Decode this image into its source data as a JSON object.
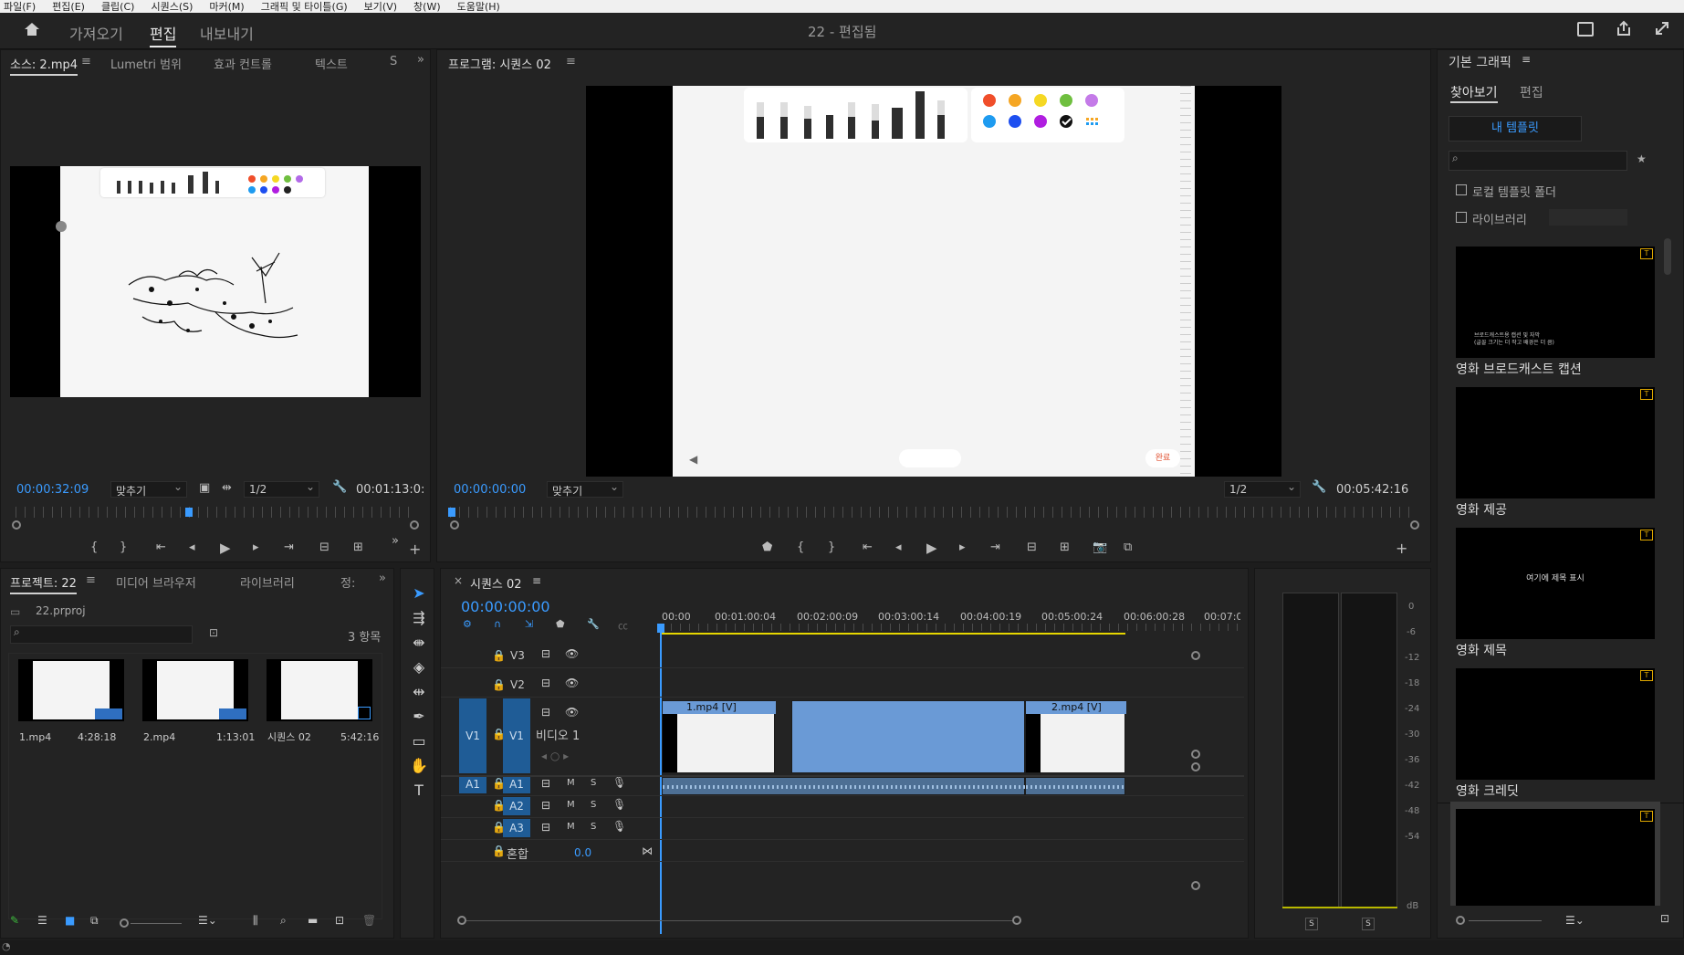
{
  "menu": [
    "파일(F)",
    "편집(E)",
    "클립(C)",
    "시퀀스(S)",
    "마커(M)",
    "그래픽 및 타이틀(G)",
    "보기(V)",
    "창(W)",
    "도움말(H)"
  ],
  "workspace": {
    "tabs": [
      "가져오기",
      "편집",
      "내보내기"
    ],
    "active": "편집",
    "title": "22 - 편집됨"
  },
  "source": {
    "tabs": [
      "소스: 2.mp4",
      "Lumetri 범위",
      "효과 컨트롤",
      "텍스트",
      "S"
    ],
    "timecode": "00:00:32:09",
    "fit": "맞추기",
    "resolution": "1/2",
    "duration": "00:01:13:0:"
  },
  "program": {
    "tab": "프로그램: 시퀀스 02",
    "timecode": "00:00:00:00",
    "fit": "맞추기",
    "resolution": "1/2",
    "duration": "00:05:42:16",
    "done_label": "완료"
  },
  "project": {
    "tabs": [
      "프로젝트: 22",
      "미디어 브라우저",
      "라이브러리",
      "정:"
    ],
    "file": "22.prproj",
    "count": "3 항목",
    "items": [
      {
        "name": "1.mp4",
        "duration": "4:28:18"
      },
      {
        "name": "2.mp4",
        "duration": "1:13:01"
      },
      {
        "name": "시퀀스 02",
        "duration": "5:42:16"
      }
    ]
  },
  "timeline": {
    "tab": "시퀀스 02",
    "timecode": "00:00:00:00",
    "ruler": [
      "00:00",
      "00:01:00:04",
      "00:02:00:09",
      "00:03:00:14",
      "00:04:00:19",
      "00:05:00:24",
      "00:06:00:28",
      "00:07:0("
    ],
    "video_tracks": [
      "V3",
      "V2",
      "V1"
    ],
    "v1_name": "비디오 1",
    "audio_tracks": [
      "A1",
      "A2",
      "A3"
    ],
    "source_patch": {
      "video": "V1",
      "audio": "A1"
    },
    "mix_label": "혼합",
    "mix_value": "0.0",
    "mute": "M",
    "solo": "S",
    "clips": [
      "1.mp4 [V]",
      "2.mp4 [V]"
    ]
  },
  "meter": {
    "scale": [
      "0",
      "-6",
      "-12",
      "-18",
      "-24",
      "-30",
      "-36",
      "-42",
      "-48",
      "-54",
      "dB"
    ],
    "solo": [
      "S",
      "S"
    ]
  },
  "essential": {
    "title": "기본 그래픽",
    "tabs": [
      "찾아보기",
      "편집"
    ],
    "active_tab": "찾아보기",
    "my_templates": "내 템플릿",
    "local_folder": "로컬 템플릿 폴더",
    "library": "라이브러리",
    "templates": [
      "영화 브로드캐스트 캡션",
      "영화 제공",
      "영화 제목",
      "영화 크레딧"
    ],
    "thumb_text_1": "브로드캐스트용 캡션 및 자막\n(글꼴 크기는 더 작고 배경은 더 큼)",
    "thumb_text_3": "여기에 제목 표시"
  },
  "colors": {
    "accent": "#3a9bff",
    "clip_blue": "#6a9ad6",
    "track_blue": "#1f5c96"
  }
}
